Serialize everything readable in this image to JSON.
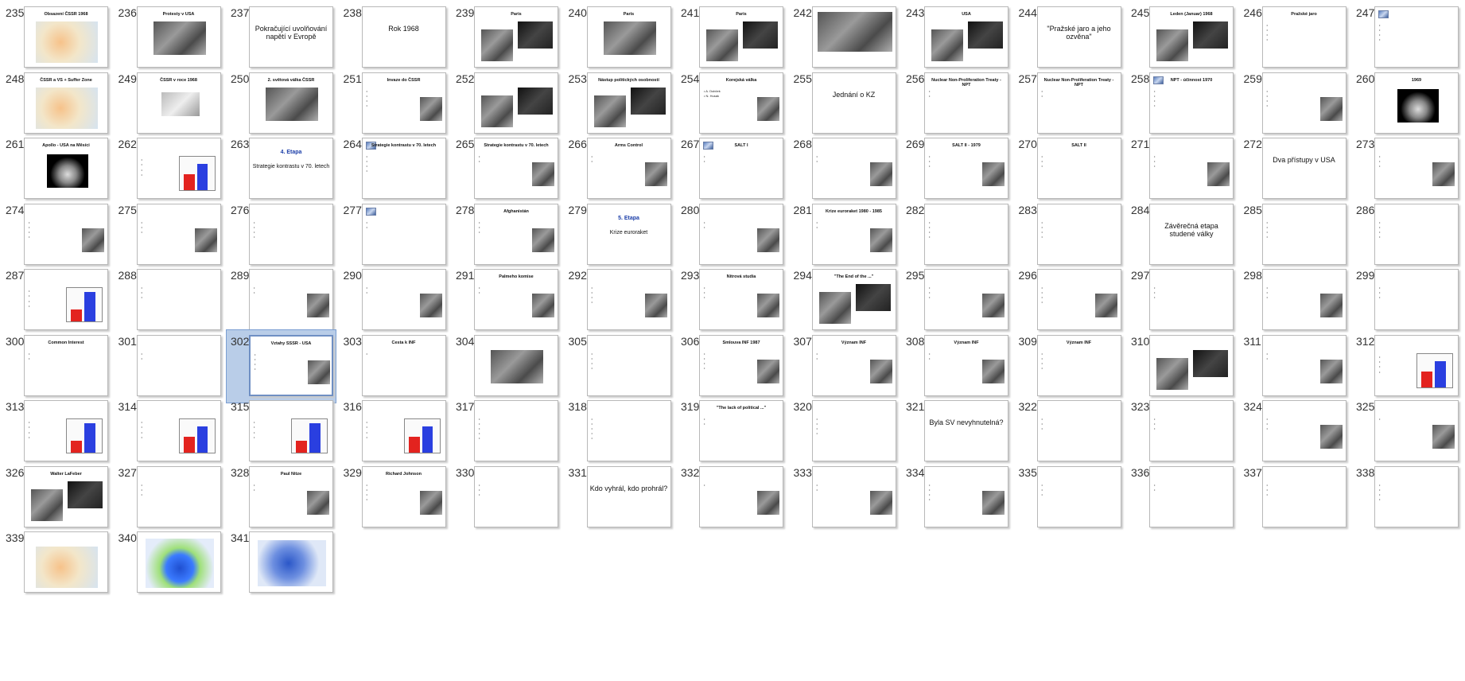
{
  "app": {
    "view": "Slide Sorter"
  },
  "slides": [
    {
      "n": "235",
      "title": "Obsazení ČSSR 1968",
      "kind": "map"
    },
    {
      "n": "236",
      "title": "Protesty v USA",
      "kind": "photo"
    },
    {
      "n": "237",
      "title": "Pokračující uvolňování napětí v Evropě",
      "kind": "bigtitle"
    },
    {
      "n": "238",
      "title": "Rok 1968",
      "kind": "bigtitle"
    },
    {
      "n": "239",
      "title": "Paris",
      "kind": "photos"
    },
    {
      "n": "240",
      "title": "Paris",
      "kind": "photo"
    },
    {
      "n": "241",
      "title": "Paris",
      "kind": "photos"
    },
    {
      "n": "242",
      "title": "",
      "kind": "photo-full"
    },
    {
      "n": "243",
      "title": "USA",
      "kind": "photos"
    },
    {
      "n": "244",
      "title": "\"Pražské jaro a jeho ozvěna\"",
      "kind": "bigtitle"
    },
    {
      "n": "245",
      "title": "Leden (Januar) 1968",
      "kind": "photos"
    },
    {
      "n": "246",
      "title": "Pražské jaro",
      "kind": "bullets",
      "bullets": [
        "",
        "",
        "",
        ""
      ]
    },
    {
      "n": "247",
      "title": "",
      "kind": "bullets-icon",
      "bullets": [
        "",
        "",
        "",
        ""
      ]
    },
    {
      "n": "248",
      "title": "ČSSR a VS + Suffer Zone",
      "kind": "map"
    },
    {
      "n": "249",
      "title": "ČSSR v roce 1968",
      "kind": "map-light"
    },
    {
      "n": "250",
      "title": "2. světová válka ČSSR",
      "kind": "photo"
    },
    {
      "n": "251",
      "title": "Invaze do ČSSR",
      "kind": "bullets-photo",
      "bullets": [
        "",
        "",
        "",
        ""
      ]
    },
    {
      "n": "252",
      "title": "",
      "kind": "photos"
    },
    {
      "n": "253",
      "title": "Nástup politických osobností",
      "kind": "photos"
    },
    {
      "n": "254",
      "title": "Korejská válka",
      "kind": "bullets-photo",
      "bullets": [
        "A. Dubček",
        "N. Husák"
      ]
    },
    {
      "n": "255",
      "title": "Jednání o KZ",
      "kind": "bigtitle"
    },
    {
      "n": "256",
      "title": "Nuclear Non-Proliferation Treaty - NPT",
      "kind": "bullets",
      "bullets": [
        "",
        ""
      ]
    },
    {
      "n": "257",
      "title": "Nuclear Non-Proliferation Treaty - NPT",
      "kind": "bullets",
      "bullets": [
        "",
        ""
      ]
    },
    {
      "n": "258",
      "title": "NPT - účinnost 1970",
      "kind": "bullets-icon",
      "bullets": [
        "",
        "",
        "",
        ""
      ]
    },
    {
      "n": "259",
      "title": "",
      "kind": "bullets-photo",
      "bullets": [
        "",
        "",
        "",
        ""
      ]
    },
    {
      "n": "260",
      "title": "1969",
      "kind": "moon"
    },
    {
      "n": "261",
      "title": "Apollo - USA na Měsíci",
      "kind": "moon"
    },
    {
      "n": "262",
      "title": "",
      "kind": "chart"
    },
    {
      "n": "263",
      "title": "4. Etapa",
      "kind": "bigtitle-blue",
      "subtitle": "Strategie kontrastu v 70. letech"
    },
    {
      "n": "264",
      "title": "Strategie kontrastu v 70. letech",
      "kind": "bullets-icon",
      "bullets": [
        "",
        "",
        "",
        ""
      ]
    },
    {
      "n": "265",
      "title": "Strategie kontrastu v 70. letech",
      "kind": "bullets-photo",
      "bullets": [
        "",
        ""
      ]
    },
    {
      "n": "266",
      "title": "Arms Control",
      "kind": "bullets-photo",
      "bullets": [
        "",
        ""
      ]
    },
    {
      "n": "267",
      "title": "SALT I",
      "kind": "bullets-icon",
      "bullets": [
        "",
        ""
      ]
    },
    {
      "n": "268",
      "title": "",
      "kind": "bullets-photo",
      "bullets": [
        "",
        ""
      ]
    },
    {
      "n": "269",
      "title": "SALT II - 1979",
      "kind": "bullets-photo",
      "bullets": [
        "",
        "",
        ""
      ]
    },
    {
      "n": "270",
      "title": "SALT II",
      "kind": "bullets",
      "bullets": [
        "",
        "",
        ""
      ]
    },
    {
      "n": "271",
      "title": "",
      "kind": "bullets-photo",
      "bullets": [
        "",
        "",
        ""
      ]
    },
    {
      "n": "272",
      "title": "Dva přístupy v USA",
      "kind": "bigtitle"
    },
    {
      "n": "273",
      "title": "",
      "kind": "bullets-photo",
      "bullets": [
        "",
        "",
        ""
      ]
    },
    {
      "n": "274",
      "title": "",
      "kind": "bullets-photo",
      "bullets": [
        "",
        "",
        "",
        ""
      ]
    },
    {
      "n": "275",
      "title": "",
      "kind": "bullets-photo",
      "bullets": [
        "",
        "",
        ""
      ]
    },
    {
      "n": "276",
      "title": "",
      "kind": "bullets",
      "bullets": [
        "",
        "",
        "",
        ""
      ]
    },
    {
      "n": "277",
      "title": "",
      "kind": "bullets-icon",
      "bullets": [
        "",
        ""
      ]
    },
    {
      "n": "278",
      "title": "Afghanistán",
      "kind": "bullets-photo",
      "bullets": [
        "",
        "",
        ""
      ]
    },
    {
      "n": "279",
      "title": "5. Etapa",
      "kind": "bigtitle-blue",
      "subtitle": "Krize euroraket"
    },
    {
      "n": "280",
      "title": "",
      "kind": "bullets-photo",
      "bullets": [
        "",
        ""
      ]
    },
    {
      "n": "281",
      "title": "Krize euroraket 1980 - 1985",
      "kind": "bullets-photo",
      "bullets": [
        "",
        ""
      ]
    },
    {
      "n": "282",
      "title": "",
      "kind": "bullets",
      "bullets": [
        "",
        "",
        "",
        ""
      ]
    },
    {
      "n": "283",
      "title": "",
      "kind": "bullets",
      "bullets": [
        "",
        "",
        "",
        ""
      ]
    },
    {
      "n": "284",
      "title": "Závěrečná etapa studené války",
      "kind": "bigtitle"
    },
    {
      "n": "285",
      "title": "",
      "kind": "bullets",
      "bullets": [
        "",
        "",
        "",
        ""
      ]
    },
    {
      "n": "286",
      "title": "",
      "kind": "bullets",
      "bullets": [
        "",
        "",
        "",
        ""
      ]
    },
    {
      "n": "287",
      "title": "",
      "kind": "chart"
    },
    {
      "n": "288",
      "title": "",
      "kind": "bullets",
      "bullets": [
        "",
        "",
        ""
      ]
    },
    {
      "n": "289",
      "title": "",
      "kind": "bullets-photo",
      "bullets": [
        "",
        ""
      ]
    },
    {
      "n": "290",
      "title": "",
      "kind": "bullets-photo",
      "bullets": [
        "",
        ""
      ]
    },
    {
      "n": "291",
      "title": "Palmeho komise",
      "kind": "bullets-photo",
      "bullets": [
        "",
        ""
      ]
    },
    {
      "n": "292",
      "title": "",
      "kind": "bullets-photo",
      "bullets": [
        "",
        "",
        "",
        ""
      ]
    },
    {
      "n": "293",
      "title": "Nitrová studia",
      "kind": "bullets-photo",
      "bullets": [
        "",
        "",
        ""
      ]
    },
    {
      "n": "294",
      "title": "\"The End of the ...\"",
      "kind": "photos"
    },
    {
      "n": "295",
      "title": "",
      "kind": "bullets-photo",
      "bullets": [
        "",
        "",
        ""
      ]
    },
    {
      "n": "296",
      "title": "",
      "kind": "bullets-photo",
      "bullets": [
        "",
        "",
        "",
        ""
      ]
    },
    {
      "n": "297",
      "title": "",
      "kind": "bullets",
      "bullets": [
        "",
        "",
        ""
      ]
    },
    {
      "n": "298",
      "title": "",
      "kind": "bullets-photo",
      "bullets": [
        "",
        "",
        ""
      ]
    },
    {
      "n": "299",
      "title": "",
      "kind": "bullets",
      "bullets": [
        "",
        "",
        ""
      ]
    },
    {
      "n": "300",
      "title": "Common Interest",
      "kind": "bullets",
      "bullets": [
        "",
        ""
      ]
    },
    {
      "n": "301",
      "title": "",
      "kind": "bullets",
      "bullets": [
        "",
        ""
      ]
    },
    {
      "n": "302",
      "title": "Vztahy SSSR - USA",
      "kind": "bullets-photo",
      "bullets": [
        "",
        "",
        "",
        ""
      ],
      "selected": true
    },
    {
      "n": "303",
      "title": "Cesta k INF",
      "kind": "bullets",
      "bullets": [
        ""
      ]
    },
    {
      "n": "304",
      "title": "",
      "kind": "photo"
    },
    {
      "n": "305",
      "title": "",
      "kind": "bullets",
      "bullets": [
        "",
        "",
        "",
        ""
      ]
    },
    {
      "n": "306",
      "title": "Smlouva INF 1987",
      "kind": "bullets-photo",
      "bullets": [
        "",
        "",
        "",
        ""
      ]
    },
    {
      "n": "307",
      "title": "Význam INF",
      "kind": "bullets-photo",
      "bullets": [
        "",
        ""
      ]
    },
    {
      "n": "308",
      "title": "Význam INF",
      "kind": "bullets-photo",
      "bullets": [
        "",
        ""
      ]
    },
    {
      "n": "309",
      "title": "Význam INF",
      "kind": "bullets",
      "bullets": [
        "",
        "",
        "",
        ""
      ]
    },
    {
      "n": "310",
      "title": "",
      "kind": "photos"
    },
    {
      "n": "311",
      "title": "",
      "kind": "bullets-photo",
      "bullets": [
        "",
        ""
      ]
    },
    {
      "n": "312",
      "title": "",
      "kind": "chart"
    },
    {
      "n": "313",
      "title": "",
      "kind": "chart"
    },
    {
      "n": "314",
      "title": "",
      "kind": "chart"
    },
    {
      "n": "315",
      "title": "",
      "kind": "chart"
    },
    {
      "n": "316",
      "title": "",
      "kind": "chart"
    },
    {
      "n": "317",
      "title": "",
      "kind": "bullets",
      "bullets": [
        "",
        "",
        "",
        "",
        ""
      ]
    },
    {
      "n": "318",
      "title": "",
      "kind": "bullets",
      "bullets": [
        "",
        "",
        "",
        "",
        ""
      ]
    },
    {
      "n": "319",
      "title": "\"The lack of political ...\"",
      "kind": "bullets",
      "bullets": [
        "",
        ""
      ]
    },
    {
      "n": "320",
      "title": "",
      "kind": "bullets",
      "bullets": [
        "",
        "",
        "",
        ""
      ]
    },
    {
      "n": "321",
      "title": "Byla SV nevyhnutelná?",
      "kind": "bigtitle"
    },
    {
      "n": "322",
      "title": "",
      "kind": "bullets",
      "bullets": [
        "",
        "",
        ""
      ]
    },
    {
      "n": "323",
      "title": "",
      "kind": "bullets",
      "bullets": [
        "",
        "",
        ""
      ]
    },
    {
      "n": "324",
      "title": "",
      "kind": "bullets-photo",
      "bullets": [
        "",
        "",
        ""
      ]
    },
    {
      "n": "325",
      "title": "",
      "kind": "bullets-photo",
      "bullets": [
        ""
      ]
    },
    {
      "n": "326",
      "title": "Walter LaFeber",
      "kind": "photos"
    },
    {
      "n": "327",
      "title": "",
      "kind": "bullets",
      "bullets": [
        "",
        "",
        ""
      ]
    },
    {
      "n": "328",
      "title": "Paul Nitze",
      "kind": "bullets-photo",
      "bullets": [
        "",
        ""
      ]
    },
    {
      "n": "329",
      "title": "Richard Johnson",
      "kind": "bullets-photo",
      "bullets": [
        "",
        "",
        "",
        ""
      ]
    },
    {
      "n": "330",
      "title": "",
      "kind": "bullets",
      "bullets": [
        "",
        "",
        ""
      ]
    },
    {
      "n": "331",
      "title": "Kdo vyhrál, kdo prohrál?",
      "kind": "bigtitle"
    },
    {
      "n": "332",
      "title": "",
      "kind": "bullets-photo",
      "bullets": [
        ""
      ]
    },
    {
      "n": "333",
      "title": "",
      "kind": "bullets-photo",
      "bullets": [
        "",
        ""
      ]
    },
    {
      "n": "334",
      "title": "",
      "kind": "bullets-photo",
      "bullets": [
        "",
        "",
        "",
        ""
      ]
    },
    {
      "n": "335",
      "title": "",
      "kind": "bullets",
      "bullets": [
        "",
        "",
        ""
      ]
    },
    {
      "n": "336",
      "title": "",
      "kind": "bullets",
      "bullets": [
        "",
        ""
      ]
    },
    {
      "n": "337",
      "title": "",
      "kind": "bullets",
      "bullets": [
        "",
        "",
        ""
      ]
    },
    {
      "n": "338",
      "title": "",
      "kind": "bullets",
      "bullets": [
        "",
        "",
        "",
        ""
      ]
    },
    {
      "n": "339",
      "title": "",
      "kind": "map"
    },
    {
      "n": "340",
      "title": "",
      "kind": "eu2"
    },
    {
      "n": "341",
      "title": "",
      "kind": "eu"
    }
  ]
}
